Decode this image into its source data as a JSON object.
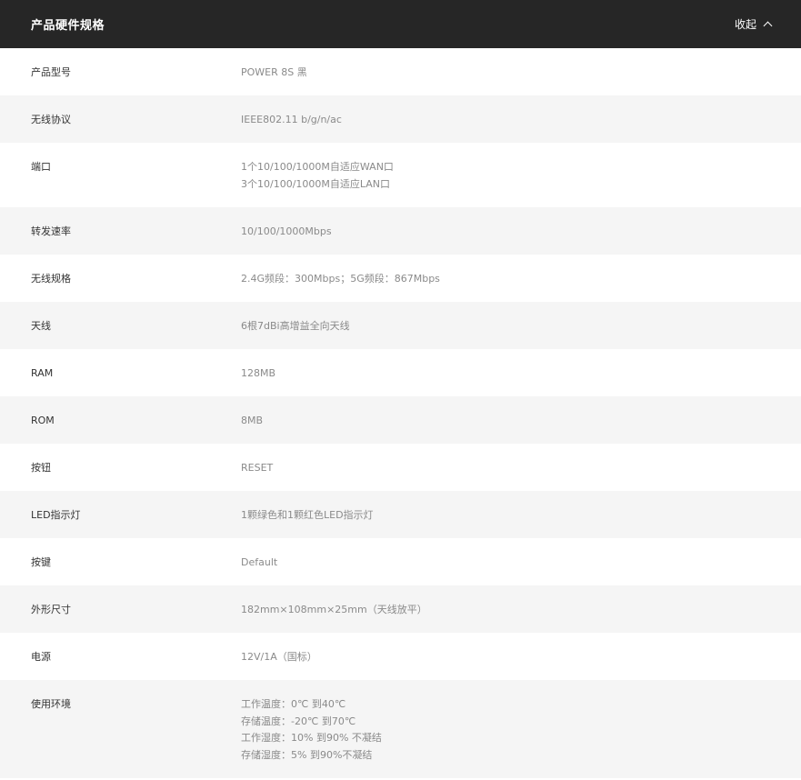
{
  "header": {
    "title": "产品硬件规格",
    "collapse_label": "收起",
    "collapse_icon": "chevron-up-icon"
  },
  "specs": [
    {
      "label": "产品型号",
      "values": [
        "POWER 8S 黑"
      ]
    },
    {
      "label": "无线协议",
      "values": [
        "IEEE802.11 b/g/n/ac"
      ]
    },
    {
      "label": "端口",
      "values": [
        "1个10/100/1000M自适应WAN口",
        "3个10/100/1000M自适应LAN口"
      ]
    },
    {
      "label": "转发速率",
      "values": [
        "10/100/1000Mbps"
      ]
    },
    {
      "label": "无线规格",
      "values": [
        "2.4G频段：300Mbps；5G频段：867Mbps"
      ]
    },
    {
      "label": "天线",
      "values": [
        "6根7dBi高增益全向天线"
      ]
    },
    {
      "label": "RAM",
      "values": [
        "128MB"
      ]
    },
    {
      "label": "ROM",
      "values": [
        "8MB"
      ]
    },
    {
      "label": "按钮",
      "values": [
        "RESET"
      ]
    },
    {
      "label": "LED指示灯",
      "values": [
        "1颗绿色和1颗红色LED指示灯"
      ]
    },
    {
      "label": "按键",
      "values": [
        "Default"
      ]
    },
    {
      "label": "外形尺寸",
      "values": [
        "182mm×108mm×25mm（天线放平）"
      ]
    },
    {
      "label": "电源",
      "values": [
        "12V/1A（国标）"
      ]
    },
    {
      "label": "使用环境",
      "values": [
        "工作温度：0℃ 到40℃",
        "存储温度：-20℃ 到70℃",
        "工作湿度：10% 到90% 不凝结",
        "存储湿度：5% 到90%不凝结"
      ]
    }
  ]
}
